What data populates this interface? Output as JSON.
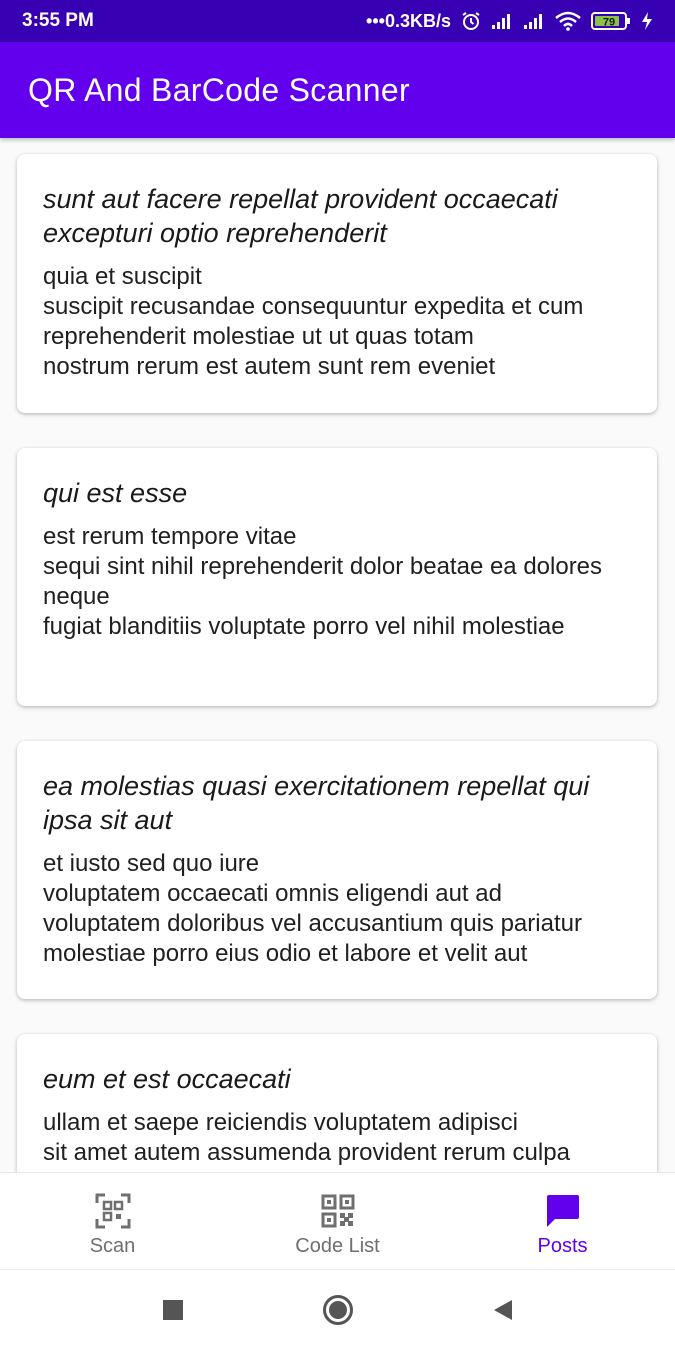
{
  "status_bar": {
    "time": "3:55 PM",
    "network_speed": "0.3KB/s",
    "battery": "79",
    "icons": [
      "alarm-icon",
      "signal-icon",
      "signal-icon",
      "wifi-icon",
      "battery-icon",
      "charging-icon"
    ]
  },
  "app_bar": {
    "title": "QR And BarCode Scanner"
  },
  "posts": [
    {
      "title": "sunt aut facere repellat provident occaecati excepturi optio reprehenderit",
      "body": "quia et suscipit\nsuscipit recusandae consequuntur expedita et cum reprehenderit molestiae ut ut quas totam\nnostrum rerum est autem sunt rem eveniet"
    },
    {
      "title": "qui est esse",
      "body": "est rerum tempore vitae\nsequi sint nihil reprehenderit dolor beatae ea dolores neque\nfugiat blanditiis voluptate porro vel nihil molestiae"
    },
    {
      "title": "ea molestias quasi exercitationem repellat qui ipsa sit aut",
      "body": "et iusto sed quo iure\nvoluptatem occaecati omnis eligendi aut ad\nvoluptatem doloribus vel accusantium quis pariatur\nmolestiae porro eius odio et labore et velit aut"
    },
    {
      "title": "eum et est occaecati",
      "body": "ullam et saepe reiciendis voluptatem adipisci\nsit amet autem assumenda provident rerum culpa"
    }
  ],
  "bottom_nav": {
    "items": [
      {
        "label": "Scan",
        "icon": "qr-scan-icon",
        "active": false
      },
      {
        "label": "Code List",
        "icon": "qr-code-icon",
        "active": false
      },
      {
        "label": "Posts",
        "icon": "message-icon",
        "active": true
      }
    ]
  },
  "colors": {
    "status_bar": "#3700b3",
    "app_bar": "#6200ee",
    "active_nav": "#6200ee",
    "inactive_nav": "#6f6f6f"
  }
}
